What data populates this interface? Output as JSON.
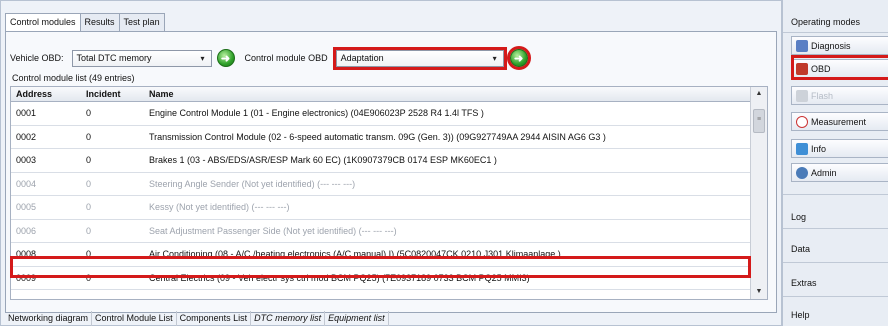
{
  "tabs_top": [
    "Control modules",
    "Results",
    "Test plan"
  ],
  "vehicle_obd": {
    "label": "Vehicle OBD:",
    "value": "Total DTC memory"
  },
  "control_module_obd": {
    "label": "Control module OBD",
    "value": "Adaptation"
  },
  "list_title": "Control module list (49 entries)",
  "columns": {
    "address": "Address",
    "incident": "Incident",
    "name": "Name"
  },
  "rows": [
    {
      "address": "0001",
      "incident": "0",
      "name": "Engine Control Module 1 (01 - Engine electronics) (04E906023P   2528  R4 1.4l TFS )"
    },
    {
      "address": "0002",
      "incident": "0",
      "name": "Transmission Control Module (02 - 6-speed automatic transm. 09G (Gen. 3)) (09G927749AA  2944  AISIN AG6 G3 )"
    },
    {
      "address": "0003",
      "incident": "0",
      "name": "Brakes 1 (03 - ABS/EDS/ASR/ESP Mark 60 EC) (1K0907379CB  0174  ESP MK60EC1 )"
    },
    {
      "address": "0004",
      "incident": "0",
      "name": "Steering Angle Sender (Not yet identified) (---  ---  ---)"
    },
    {
      "address": "0005",
      "incident": "0",
      "name": "Kessy (Not yet identified) (---  ---  ---)"
    },
    {
      "address": "0006",
      "incident": "0",
      "name": "Seat Adjustment Passenger Side (Not yet identified) (---  ---  ---)"
    },
    {
      "address": "0008",
      "incident": "0",
      "name": "Air Conditioning (08 - A/C /heating electronics (A/C manual) I) (5C0820047CK   0210  J301  Klimaanlage )"
    },
    {
      "address": "0009",
      "incident": "0",
      "name": "Central Electrics (09 - Veh electr sys ctrl mod BCM PQ25) (7E0937189    0733  BCM PQ25 MMI3)"
    }
  ],
  "tabs_bottom": [
    "Networking diagram",
    "Control Module List",
    "Components List",
    "DTC memory list",
    "Equipment list"
  ],
  "sidebar": {
    "title": "Operating modes",
    "buttons": [
      "Diagnosis",
      "OBD",
      "Flash",
      "Measurement",
      "Info",
      "Admin"
    ],
    "sections": [
      "Log",
      "Data",
      "Extras",
      "Help"
    ]
  },
  "colors": {
    "highlight": "#d41a1a",
    "go_button": "#2fa12a"
  }
}
